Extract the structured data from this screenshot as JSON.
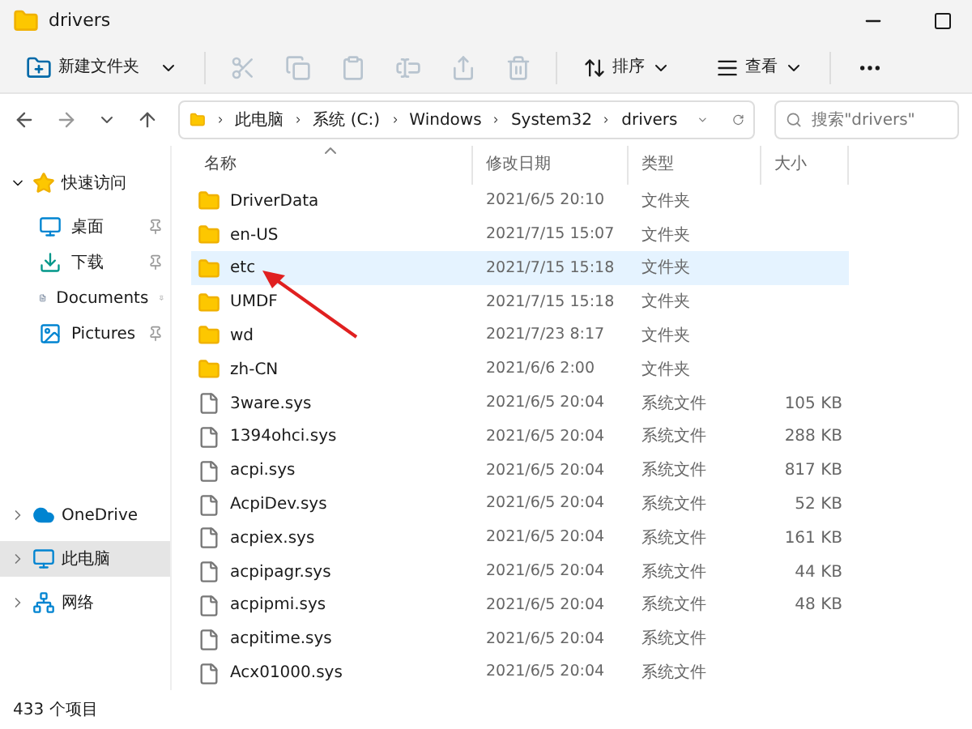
{
  "window": {
    "title": "drivers"
  },
  "toolbar": {
    "new_folder": "新建文件夹",
    "actions": [
      {
        "kind": "cut",
        "disabled": true
      },
      {
        "kind": "copy",
        "disabled": true
      },
      {
        "kind": "paste",
        "disabled": true
      },
      {
        "kind": "rename",
        "disabled": true
      },
      {
        "kind": "share",
        "disabled": true
      },
      {
        "kind": "delete",
        "disabled": true
      }
    ],
    "sort": "排序",
    "view": "查看"
  },
  "address": {
    "segments": [
      "此电脑",
      "系统 (C:)",
      "Windows",
      "System32",
      "drivers"
    ],
    "search_placeholder": "搜索\"drivers\""
  },
  "sidebar": {
    "groups": [
      {
        "kind": "quick",
        "label": "快速访问",
        "expanded": true,
        "selected": false,
        "children": [
          {
            "kind": "desktop",
            "label": "桌面",
            "pinned": true
          },
          {
            "kind": "downloads",
            "label": "下载",
            "pinned": true
          },
          {
            "kind": "documents",
            "label": "Documents",
            "pinned": true
          },
          {
            "kind": "pictures",
            "label": "Pictures",
            "pinned": true
          }
        ]
      },
      {
        "kind": "cloud",
        "label": "OneDrive",
        "expanded": false,
        "selected": false
      },
      {
        "kind": "pc",
        "label": "此电脑",
        "expanded": false,
        "selected": true
      },
      {
        "kind": "network",
        "label": "网络",
        "expanded": false,
        "selected": false
      }
    ]
  },
  "table": {
    "columns": [
      {
        "label": "名称",
        "sorted": true
      },
      {
        "label": "修改日期",
        "sorted": false
      },
      {
        "label": "类型",
        "sorted": false
      },
      {
        "label": "大小",
        "sorted": false
      }
    ],
    "rows": [
      {
        "kind": "folder",
        "name": "DriverData",
        "modified": "2021/6/5 20:10",
        "type": "文件夹",
        "selected": false
      },
      {
        "kind": "folder",
        "name": "en-US",
        "modified": "2021/7/15 15:07",
        "type": "文件夹",
        "selected": false
      },
      {
        "kind": "folder",
        "name": "etc",
        "modified": "2021/7/15 15:18",
        "type": "文件夹",
        "selected": true
      },
      {
        "kind": "folder",
        "name": "UMDF",
        "modified": "2021/7/15 15:18",
        "type": "文件夹",
        "selected": false
      },
      {
        "kind": "folder",
        "name": "wd",
        "modified": "2021/7/23 8:17",
        "type": "文件夹",
        "selected": false
      },
      {
        "kind": "folder",
        "name": "zh-CN",
        "modified": "2021/6/6 2:00",
        "type": "文件夹",
        "selected": false
      },
      {
        "kind": "file",
        "name": "3ware.sys",
        "modified": "2021/6/5 20:04",
        "type": "系统文件",
        "size": "105 KB",
        "selected": false
      },
      {
        "kind": "file",
        "name": "1394ohci.sys",
        "modified": "2021/6/5 20:04",
        "type": "系统文件",
        "size": "288 KB",
        "selected": false
      },
      {
        "kind": "file",
        "name": "acpi.sys",
        "modified": "2021/6/5 20:04",
        "type": "系统文件",
        "size": "817 KB",
        "selected": false
      },
      {
        "kind": "file",
        "name": "AcpiDev.sys",
        "modified": "2021/6/5 20:04",
        "type": "系统文件",
        "size": "52 KB",
        "selected": false
      },
      {
        "kind": "file",
        "name": "acpiex.sys",
        "modified": "2021/6/5 20:04",
        "type": "系统文件",
        "size": "161 KB",
        "selected": false
      },
      {
        "kind": "file",
        "name": "acpipagr.sys",
        "modified": "2021/6/5 20:04",
        "type": "系统文件",
        "size": "44 KB",
        "selected": false
      },
      {
        "kind": "file",
        "name": "acpipmi.sys",
        "modified": "2021/6/5 20:04",
        "type": "系统文件",
        "size": "48 KB",
        "selected": false
      },
      {
        "kind": "file",
        "name": "acpitime.sys",
        "modified": "2021/6/5 20:04",
        "type": "系统文件",
        "selected": false
      },
      {
        "kind": "file",
        "name": "Acx01000.sys",
        "modified": "2021/6/5 20:04",
        "type": "系统文件",
        "selected": false
      }
    ]
  },
  "status_bar": {
    "count": "433 个项目"
  }
}
